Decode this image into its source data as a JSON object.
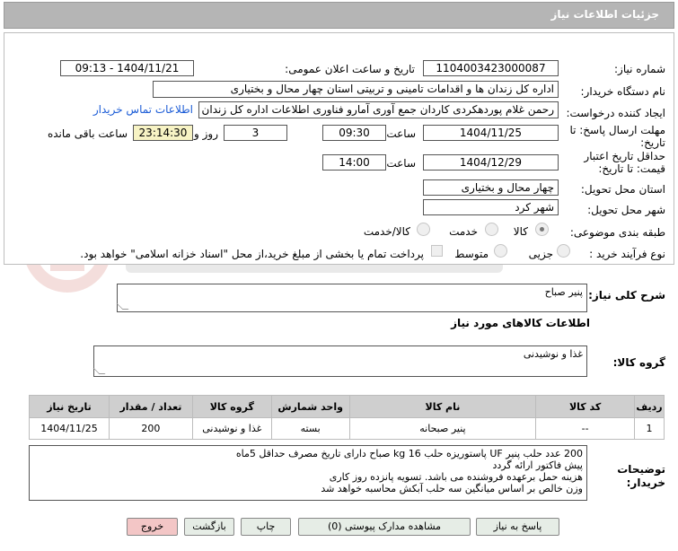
{
  "header": {
    "title": "جزئیات اطلاعات نیاز"
  },
  "form": {
    "need_number_label": "شماره نیاز:",
    "need_number": "1104003423000087",
    "announce_label": "تاریخ و ساعت اعلان عمومی:",
    "announce_value": "1404/11/21 - 09:13",
    "buyer_org_label": "نام دستگاه خریدار:",
    "buyer_org": "اداره کل زندان ها و اقدامات تامینی و تربیتی استان چهار محال و بختیاری",
    "requester_label": "ایجاد کننده درخواست:",
    "requester": "رحمن غلام پوردهکردی کاردان جمع آوری آمارو فناوری اطلاعات اداره کل زندان ها",
    "contact_link": "اطلاعات تماس خریدار",
    "deadline_label_1": "مهلت ارسال پاسخ: تا",
    "deadline_label_2": "تاریخ:",
    "deadline_date": "1404/11/25",
    "time_label": "ساعت",
    "deadline_time": "09:30",
    "days_value": "3",
    "days_label": "روز و",
    "remaining_time": "23:14:30",
    "remaining_label": "ساعت باقی مانده",
    "validity_label_1": "حداقل تاریخ اعتبار",
    "validity_label_2": "قیمت: تا تاریخ:",
    "validity_date": "1404/12/29",
    "validity_time": "14:00",
    "province_label": "استان محل تحویل:",
    "province": "چهار محال و بختیاری",
    "city_label": "شهر محل تحویل:",
    "city": "شهر کرد",
    "category_label": "طبقه بندی موضوعی:",
    "category_options": [
      "کالا",
      "خدمت",
      "کالا/خدمت"
    ],
    "process_label": "نوع فرآیند خرید :",
    "process_options": [
      "جزیی",
      "متوسط"
    ],
    "payment_note": "پرداخت تمام یا بخشی از مبلغ خرید،از محل \"اسناد خزانه اسلامی\" خواهد بود."
  },
  "summary": {
    "label": "شرح کلی نیاز:",
    "value": "پنیر صباح"
  },
  "goods": {
    "section_title": "اطلاعات کالاهای مورد نیاز",
    "group_label": "گروه کالا:",
    "group_value": "غذا و نوشیدنی"
  },
  "table": {
    "headers": [
      "ردیف",
      "کد کالا",
      "نام کالا",
      "واحد شمارش",
      "گروه کالا",
      "تعداد / مقدار",
      "تاریخ نیاز"
    ],
    "rows": [
      [
        "1",
        "--",
        "پنیر صبحانه",
        "بسته",
        "غذا و نوشیدنی",
        "200",
        "1404/11/25"
      ]
    ]
  },
  "buyer_notes": {
    "label_1": "توضیحات",
    "label_2": "خریدار:",
    "lines": [
      "200 عدد حلب پنیر UF پاستوریزه حلب kg 16   صباح دارای تاریخ مصرف حداقل 5ماه",
      "پیش فاکتور ارائه گردد",
      "هزینه حمل برعهده فروشنده می باشد. تسویه پانزده روز کاری",
      "وزن خالص بر اساس میانگین سه حلب آبکش محاسبه خواهد شد"
    ]
  },
  "buttons": {
    "reply": "پاسخ به نیاز",
    "attachments": "مشاهده مدارک پیوستی (0)",
    "print": "چاپ",
    "back": "بازگشت",
    "exit": "خروج"
  },
  "colors": {
    "header_bg": "#b5b5b5",
    "link": "#1a5bd6",
    "remaining_bg": "#f7f3c4",
    "exit_bg": "#f3c6c6",
    "button_bg": "#e6ede6"
  }
}
